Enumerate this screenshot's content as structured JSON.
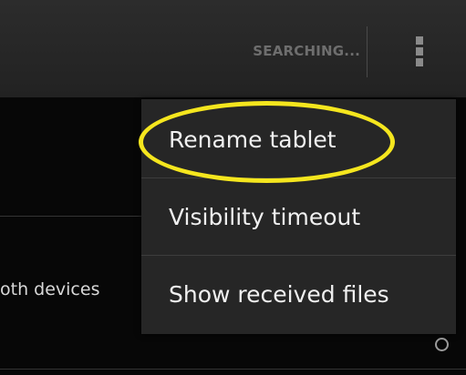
{
  "action_bar": {
    "status_text": "SEARCHING...",
    "overflow_icon": "overflow-menu-icon"
  },
  "list": {
    "partial_item_text": "oth devices",
    "radio_icon": "radio-button-icon"
  },
  "menu": {
    "items": [
      {
        "label": "Rename tablet"
      },
      {
        "label": "Visibility timeout"
      },
      {
        "label": "Show received files"
      }
    ]
  },
  "annotation": {
    "highlight_color": "#f5e61e"
  },
  "colors": {
    "menu_background": "#262626",
    "action_bar_background": "#2a2a2a",
    "text": "#f0f0f0"
  }
}
